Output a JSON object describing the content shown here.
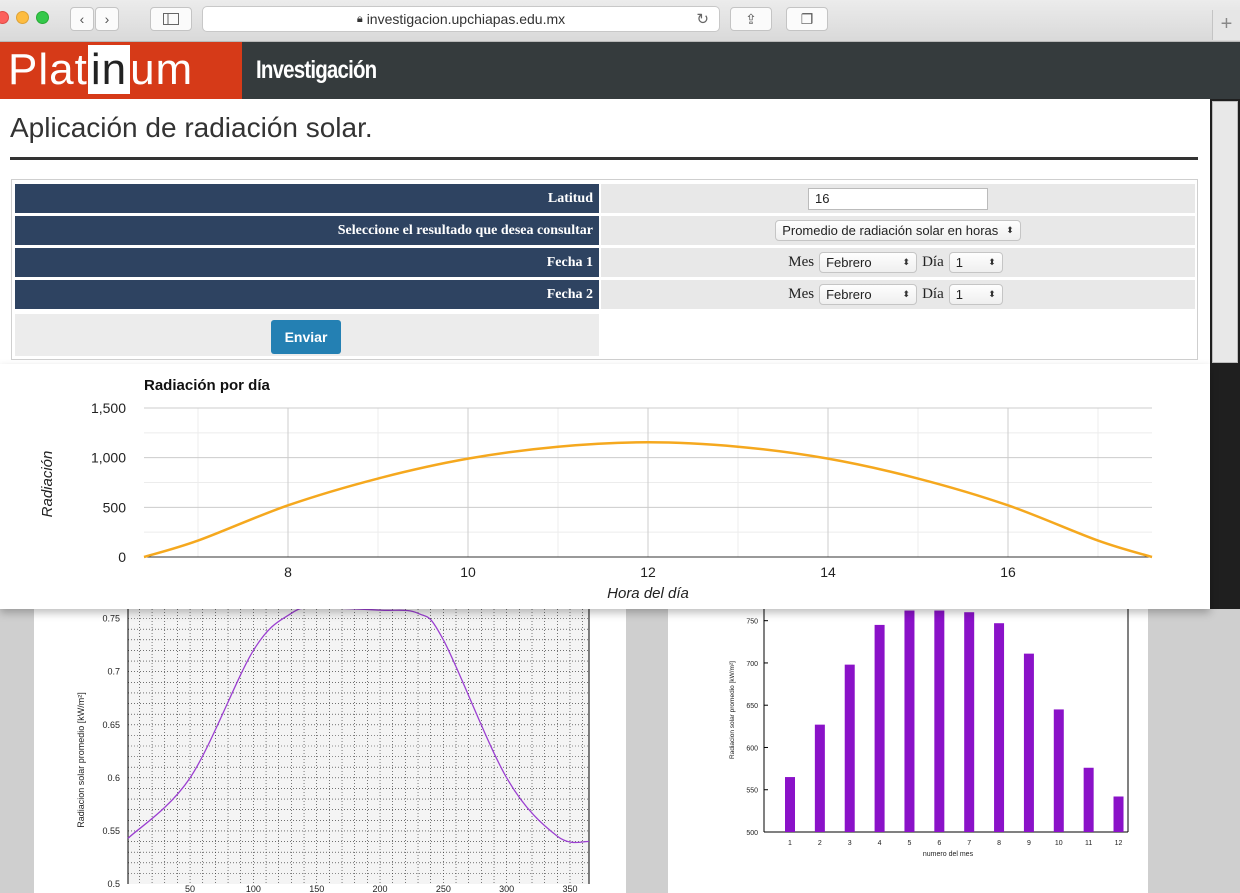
{
  "browser": {
    "url": "investigacion.upchiapas.edu.mx",
    "plus": "+"
  },
  "header": {
    "brand_pre": "Plat",
    "brand_mid": "in",
    "brand_post": "um",
    "section": "Investigación"
  },
  "page": {
    "title": "Aplicación de radiación solar."
  },
  "form": {
    "rows": [
      {
        "label": "Latitud",
        "value": "16"
      },
      {
        "label": "Seleccione el resultado que desea consultar",
        "value": "Promedio de radiación solar en horas"
      },
      {
        "label": "Fecha 1",
        "mes_label": "Mes",
        "mes_value": "Febrero",
        "dia_label": "Día",
        "dia_value": "1"
      },
      {
        "label": "Fecha 2",
        "mes_label": "Mes",
        "mes_value": "Febrero",
        "dia_label": "Día",
        "dia_value": "1"
      }
    ],
    "submit_label": "Enviar"
  },
  "chart_data": [
    {
      "type": "line",
      "title": "Radiación por día",
      "xlabel": "Hora del día",
      "ylabel": "Radiación",
      "xlim": [
        6.4,
        17.6
      ],
      "ylim": [
        0,
        1500
      ],
      "xticks": [
        8,
        10,
        12,
        14,
        16
      ],
      "yticks": [
        0,
        500,
        1000,
        1500
      ],
      "ytick_labels": [
        "0",
        "500",
        "1,000",
        "1,500"
      ],
      "grid": true,
      "color": "#f5a81e",
      "x": [
        6.4,
        7,
        8,
        9,
        10,
        11,
        12,
        13,
        14,
        15,
        16,
        17,
        17.6
      ],
      "y": [
        0,
        165,
        520,
        790,
        990,
        1110,
        1155,
        1110,
        990,
        790,
        520,
        165,
        0
      ]
    },
    {
      "type": "line",
      "ylabel": "Radiacion solar promedio [kW/m²]",
      "ylim": [
        0.5,
        0.76
      ],
      "ytick_labels": [
        "0.5",
        "0.55",
        "0.6",
        "0.65",
        "0.7",
        "0.75"
      ],
      "xtick_labels": [
        "50",
        "100",
        "150",
        "200",
        "250",
        "300",
        "350"
      ],
      "grid": true,
      "color": "#9b3fd1",
      "x": [
        1,
        50,
        100,
        130,
        150,
        200,
        230,
        250,
        300,
        340,
        365
      ],
      "y": [
        0.543,
        0.6,
        0.72,
        0.755,
        0.76,
        0.758,
        0.755,
        0.73,
        0.6,
        0.545,
        0.54
      ]
    },
    {
      "type": "bar",
      "xlabel": "numero del mes",
      "ylabel": "Radiacion solar promedio [kW/m²]",
      "categories": [
        "1",
        "2",
        "3",
        "4",
        "5",
        "6",
        "7",
        "8",
        "9",
        "10",
        "11",
        "12"
      ],
      "values": [
        565,
        627,
        698,
        745,
        762,
        762,
        760,
        747,
        711,
        645,
        576,
        542
      ],
      "ylim": [
        500,
        765
      ],
      "ytick_labels": [
        "500",
        "550",
        "600",
        "650",
        "700",
        "750"
      ],
      "color": "#8a12c8"
    }
  ]
}
